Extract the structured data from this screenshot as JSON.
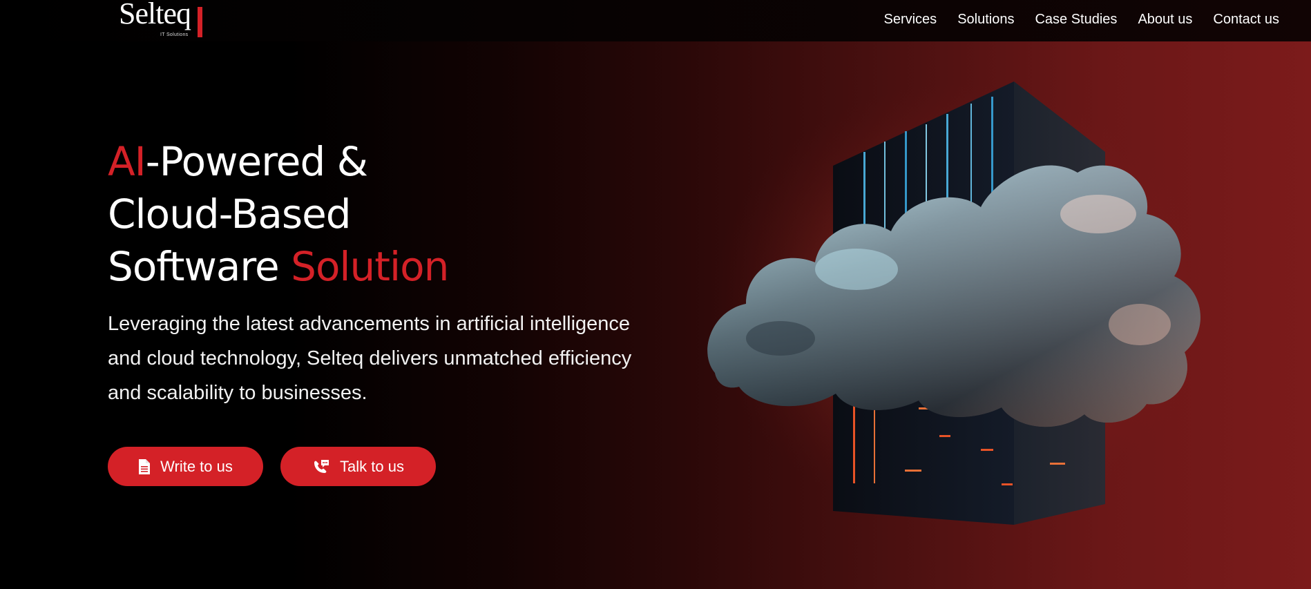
{
  "brand": {
    "name": "Selteq",
    "tagline": "IT Solutions",
    "accent_color": "#d42127"
  },
  "nav": {
    "items": [
      {
        "label": "Services"
      },
      {
        "label": "Solutions"
      },
      {
        "label": "Case Studies"
      },
      {
        "label": "About us"
      },
      {
        "label": "Contact us"
      }
    ]
  },
  "hero": {
    "title_part1_red": "AI",
    "title_part1": "-Powered &",
    "title_line2": "Cloud-Based",
    "title_line3": "Software ",
    "title_line3_red": "Solution",
    "description": "Leveraging the latest advancements in artificial intelligence and cloud technology, Selteq delivers unmatched efficiency and scalability to businesses.",
    "buttons": [
      {
        "label": "Write to us",
        "icon": "document-icon"
      },
      {
        "label": "Talk to us",
        "icon": "phone-chat-icon"
      }
    ]
  },
  "illustration": {
    "icon": "cloud-server-illustration"
  }
}
